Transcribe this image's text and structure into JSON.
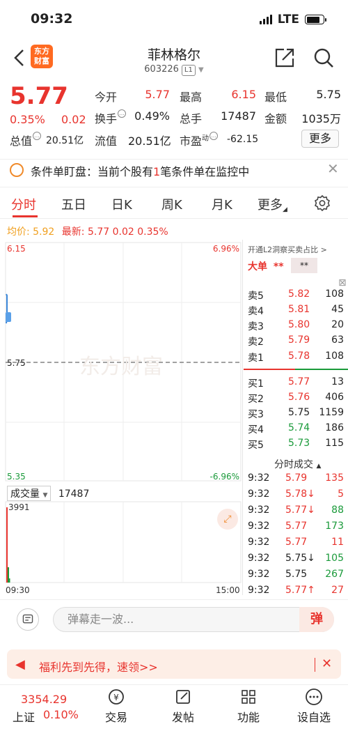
{
  "status": {
    "time": "09:32",
    "network": "LTE"
  },
  "header": {
    "logo_line1": "东方",
    "logo_line2": "财富",
    "name": "菲林格尔",
    "code": "603226",
    "level": "L1"
  },
  "quote": {
    "price": "5.77",
    "pct": "0.35%",
    "chg": "0.02",
    "open_label": "今开",
    "open": "5.77",
    "high_label": "最高",
    "high": "6.15",
    "low_label": "最低",
    "low": "5.75",
    "turnover_label": "换手",
    "turnover": "0.49%",
    "volume_label": "总手",
    "volume": "17487",
    "amount_label": "金额",
    "amount": "1035万",
    "mktcap_label": "总值",
    "mktcap": "20.51亿",
    "float_label": "流值",
    "float": "20.51亿",
    "pe_label": "市盈",
    "pe_sup": "动",
    "pe": "-62.15",
    "more": "更多"
  },
  "monitor": {
    "prefix": "条件单盯盘：当前个股有",
    "count": "1",
    "suffix": "笔条件单在监控中"
  },
  "tabs": [
    "分时",
    "五日",
    "日K",
    "周K",
    "月K",
    "更多"
  ],
  "avg": {
    "avg_label": "均价:",
    "avg": "5.92",
    "latest_label": "最新:",
    "latest": "5.77",
    "chg": "0.02",
    "pct": "0.35%"
  },
  "chart": {
    "top_price": "6.15",
    "top_pct": "6.96%",
    "bottom_price": "5.35",
    "bottom_pct": "-6.96%",
    "ref_price": "5.75",
    "watermark": "东方财富",
    "vol_label": "成交量",
    "vol_value": "17487",
    "vol_max": "3991",
    "time_start": "09:30",
    "time_end": "15:00"
  },
  "book": {
    "l2_link": "开通L2洞察买卖占比 >",
    "bigorder": "大单",
    "bigorder_val": "**",
    "bigorder_box": "**",
    "asks": [
      {
        "label": "卖5",
        "price": "5.82",
        "vol": "108"
      },
      {
        "label": "卖4",
        "price": "5.81",
        "vol": "45"
      },
      {
        "label": "卖3",
        "price": "5.80",
        "vol": "20"
      },
      {
        "label": "卖2",
        "price": "5.79",
        "vol": "63"
      },
      {
        "label": "卖1",
        "price": "5.78",
        "vol": "108"
      }
    ],
    "bids": [
      {
        "label": "买1",
        "price": "5.77",
        "vol": "13"
      },
      {
        "label": "买2",
        "price": "5.76",
        "vol": "406"
      },
      {
        "label": "买3",
        "price": "5.75",
        "vol": "1159"
      },
      {
        "label": "买4",
        "price": "5.74",
        "vol": "186"
      },
      {
        "label": "买5",
        "price": "5.73",
        "vol": "115"
      }
    ],
    "trades_title": "分时成交",
    "trades": [
      {
        "time": "9:32",
        "price": "5.79",
        "vol": "135",
        "pc": "red",
        "vc": "red"
      },
      {
        "time": "9:32",
        "price": "5.78↓",
        "vol": "5",
        "pc": "red",
        "vc": "red"
      },
      {
        "time": "9:32",
        "price": "5.77↓",
        "vol": "88",
        "pc": "red",
        "vc": "green"
      },
      {
        "time": "9:32",
        "price": "5.77",
        "vol": "173",
        "pc": "red",
        "vc": "green"
      },
      {
        "time": "9:32",
        "price": "5.77",
        "vol": "11",
        "pc": "red",
        "vc": "red"
      },
      {
        "time": "9:32",
        "price": "5.75↓",
        "vol": "105",
        "pc": "black",
        "vc": "green"
      },
      {
        "time": "9:32",
        "price": "5.75",
        "vol": "267",
        "pc": "black",
        "vc": "green"
      },
      {
        "time": "9:32",
        "price": "5.77↑",
        "vol": "27",
        "pc": "red",
        "vc": "red"
      }
    ]
  },
  "comment": {
    "placeholder": "弹幕走一波...",
    "button": "弹"
  },
  "promo": {
    "text": "福利先到先得，速领>>"
  },
  "nav": {
    "index_value": "3354.29",
    "index_name": "上证",
    "index_pct": "0.10%",
    "items": [
      "交易",
      "发帖",
      "功能",
      "设自选"
    ]
  },
  "colors": {
    "up": "#e8342e",
    "down": "#1a9a3a",
    "accent": "#ff6a21"
  }
}
